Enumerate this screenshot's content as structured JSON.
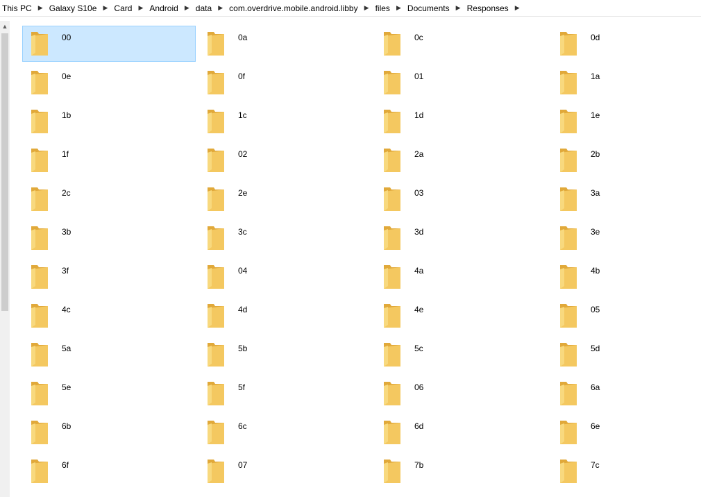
{
  "breadcrumb": [
    "This PC",
    "Galaxy S10e",
    "Card",
    "Android",
    "data",
    "com.overdrive.mobile.android.libby",
    "files",
    "Documents",
    "Responses"
  ],
  "colors": {
    "selection_bg": "#cce8ff",
    "selection_border": "#99d1ff",
    "folder": "#f4c860"
  },
  "folders": [
    {
      "name": "00",
      "selected": true
    },
    {
      "name": "0a"
    },
    {
      "name": "0c"
    },
    {
      "name": "0d"
    },
    {
      "name": "0e"
    },
    {
      "name": "0f"
    },
    {
      "name": "01"
    },
    {
      "name": "1a"
    },
    {
      "name": "1b"
    },
    {
      "name": "1c"
    },
    {
      "name": "1d"
    },
    {
      "name": "1e"
    },
    {
      "name": "1f"
    },
    {
      "name": "02"
    },
    {
      "name": "2a"
    },
    {
      "name": "2b"
    },
    {
      "name": "2c"
    },
    {
      "name": "2e"
    },
    {
      "name": "03"
    },
    {
      "name": "3a"
    },
    {
      "name": "3b"
    },
    {
      "name": "3c"
    },
    {
      "name": "3d"
    },
    {
      "name": "3e"
    },
    {
      "name": "3f"
    },
    {
      "name": "04"
    },
    {
      "name": "4a"
    },
    {
      "name": "4b"
    },
    {
      "name": "4c"
    },
    {
      "name": "4d"
    },
    {
      "name": "4e"
    },
    {
      "name": "05"
    },
    {
      "name": "5a"
    },
    {
      "name": "5b"
    },
    {
      "name": "5c"
    },
    {
      "name": "5d"
    },
    {
      "name": "5e"
    },
    {
      "name": "5f"
    },
    {
      "name": "06"
    },
    {
      "name": "6a"
    },
    {
      "name": "6b"
    },
    {
      "name": "6c"
    },
    {
      "name": "6d"
    },
    {
      "name": "6e"
    },
    {
      "name": "6f"
    },
    {
      "name": "07"
    },
    {
      "name": "7b"
    },
    {
      "name": "7c"
    }
  ]
}
